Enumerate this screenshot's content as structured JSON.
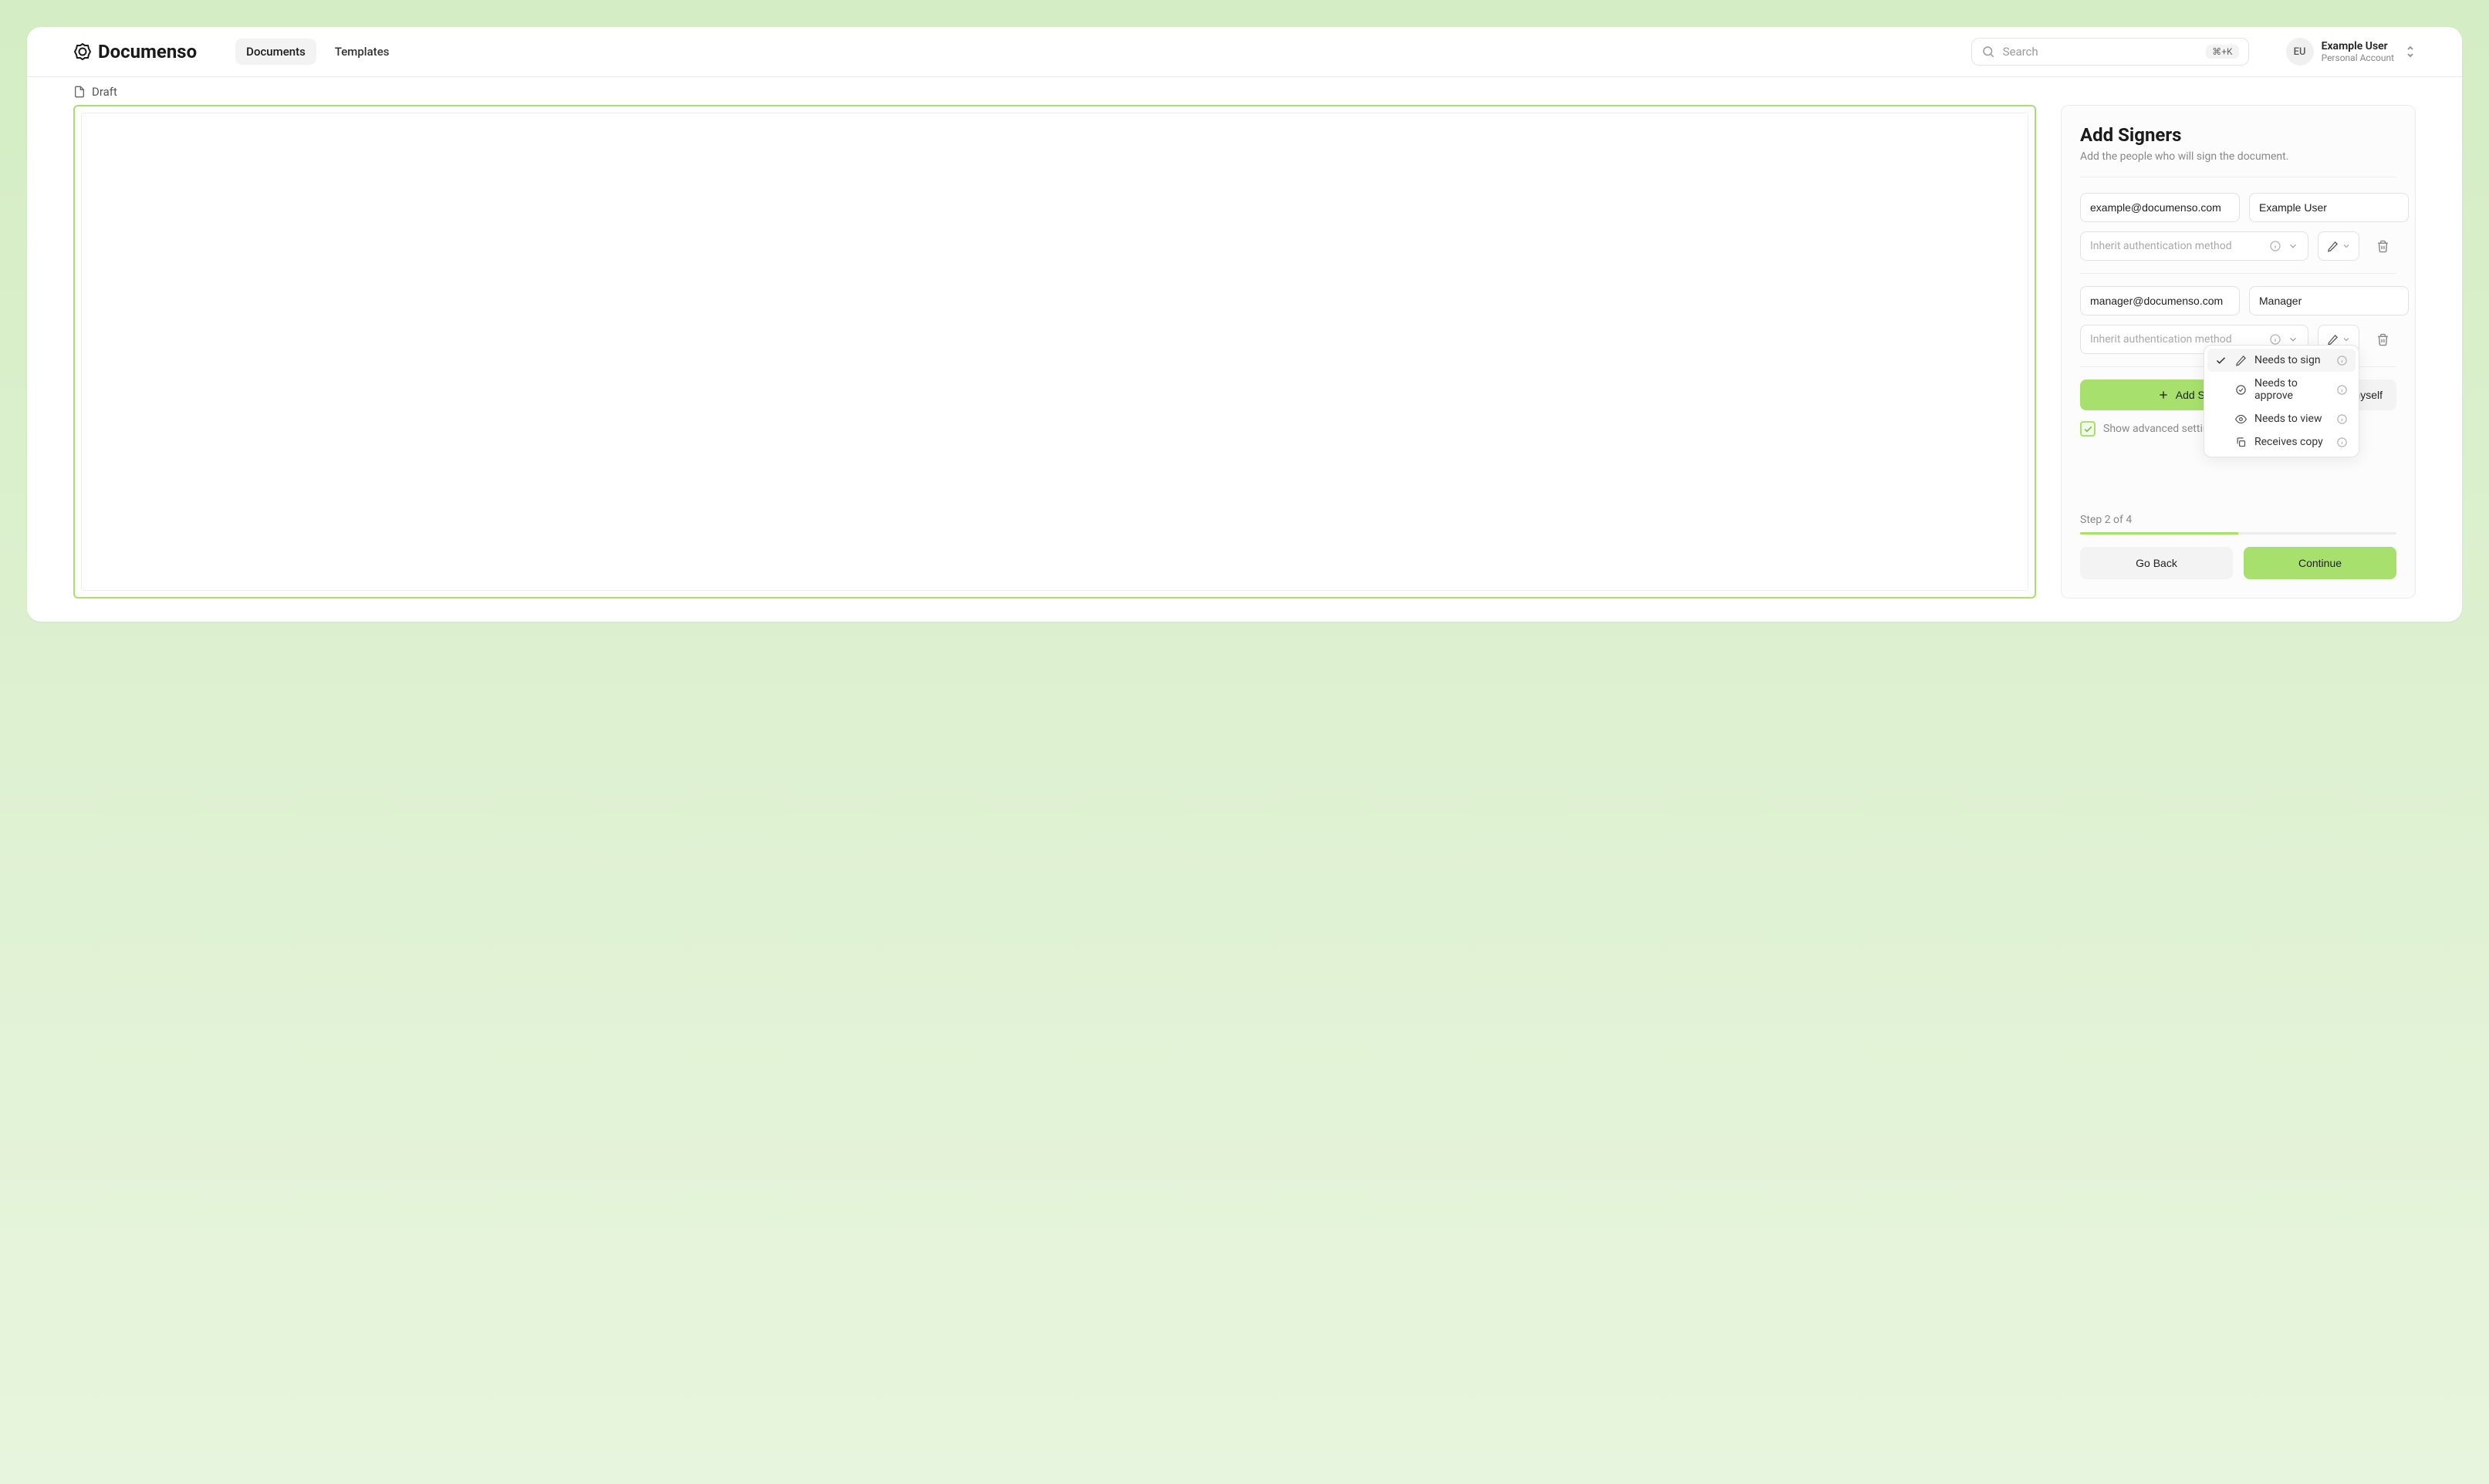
{
  "brand": "Documenso",
  "nav": {
    "documents": "Documents",
    "templates": "Templates"
  },
  "search": {
    "placeholder": "Search",
    "shortcut": "⌘+K"
  },
  "user": {
    "initials": "EU",
    "name": "Example User",
    "account": "Personal Account"
  },
  "doc_status": "Draft",
  "panel": {
    "title": "Add Signers",
    "subtitle": "Add the people who will sign the document."
  },
  "signers": [
    {
      "email": "example@documenso.com",
      "name": "Example User",
      "auth_placeholder": "Inherit authentication method"
    },
    {
      "email": "manager@documenso.com",
      "name": "Manager",
      "auth_placeholder": "Inherit authentication method"
    }
  ],
  "actions": {
    "add_signer": "Add Signer",
    "add_myself": "Add myself",
    "show_advanced": "Show advanced settings"
  },
  "role_menu": {
    "sign": "Needs to sign",
    "approve": "Needs to approve",
    "view": "Needs to view",
    "copy": "Receives copy"
  },
  "footer": {
    "step": "Step 2 of 4",
    "back": "Go Back",
    "continue": "Continue"
  }
}
